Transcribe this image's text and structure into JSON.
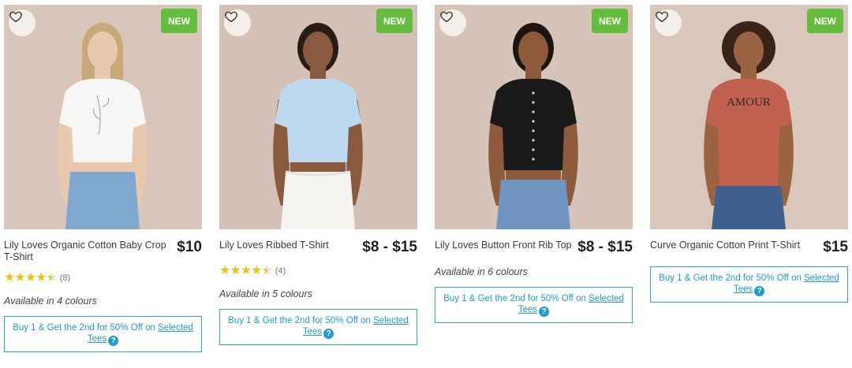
{
  "products": [
    {
      "name": "Lily Loves Organic Cotton Baby Crop T-Shirt",
      "price": "$10",
      "badge": "NEW",
      "rating": 4.5,
      "review_count": "(8)",
      "colours": "Available in 4 colours",
      "promo_prefix": "Buy 1 & Get the 2nd for 50% Off on ",
      "promo_link": "Selected Tees",
      "top_color": "#f6f6f4",
      "bottom_color": "#7fa7cf",
      "bg_color": "#d8c6bb"
    },
    {
      "name": "Lily Loves Ribbed T-Shirt",
      "price": "$8 - $15",
      "badge": "NEW",
      "rating": 4.5,
      "review_count": "(4)",
      "colours": "Available in 5 colours",
      "promo_prefix": "Buy 1 & Get the 2nd for 50% Off on ",
      "promo_link": "Selected Tees",
      "top_color": "#bcd9ef",
      "bottom_color": "#f7f5f2",
      "bg_color": "#d3c1b7"
    },
    {
      "name": "Lily Loves Button Front Rib Top",
      "price": "$8 - $15",
      "badge": "NEW",
      "rating": null,
      "review_count": "",
      "colours": "Available in 6 colours",
      "promo_prefix": "Buy 1 & Get the 2nd for 50% Off on ",
      "promo_link": "Selected Tees",
      "top_color": "#1a1a1a",
      "bottom_color": "#6f95c0",
      "bg_color": "#d6c4b9"
    },
    {
      "name": "Curve Organic Cotton Print T-Shirt",
      "price": "$15",
      "badge": "NEW",
      "rating": null,
      "review_count": "",
      "colours": "",
      "promo_prefix": "Buy 1 & Get the 2nd for 50% Off on ",
      "promo_link": "Selected Tees",
      "top_color": "#c1614f",
      "bottom_color": "#3f5f8f",
      "bg_color": "#d9c7bc",
      "print_text": "AMOUR"
    }
  ],
  "icons": {
    "wishlist": "heart-outline-icon",
    "help": "question-icon",
    "help_glyph": "?"
  },
  "colors": {
    "new_badge": "#64bd3c",
    "promo_accent": "#1f9bd1",
    "star": "#f2c21b"
  }
}
